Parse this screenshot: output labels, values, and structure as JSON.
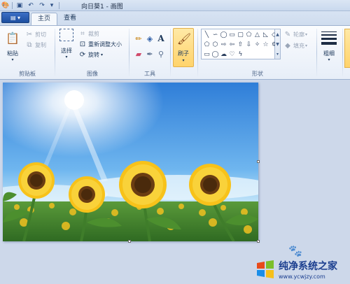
{
  "window": {
    "title": "向日葵1 - 画图"
  },
  "tabs": [
    {
      "label": "主页"
    },
    {
      "label": "查看"
    }
  ],
  "clipboard": {
    "paste": "粘贴",
    "cut": "剪切",
    "copy": "复制",
    "group": "剪贴板"
  },
  "image": {
    "select": "选择",
    "crop": "裁剪",
    "resize": "重新调整大小",
    "rotate": "旋转",
    "group": "图像"
  },
  "tools": {
    "group": "工具"
  },
  "brushes": {
    "label": "刷子"
  },
  "shapes": {
    "outline": "轮廓",
    "fill": "填充",
    "group": "形状"
  },
  "size": {
    "label": "粗细"
  },
  "watermark": {
    "title": "纯净系统之家",
    "url": "www.ycwjzy.com"
  },
  "colors": {
    "accent": "#1d4e9f",
    "brush_highlight": "#ffd36b",
    "workspace": "#cdd8ea"
  }
}
